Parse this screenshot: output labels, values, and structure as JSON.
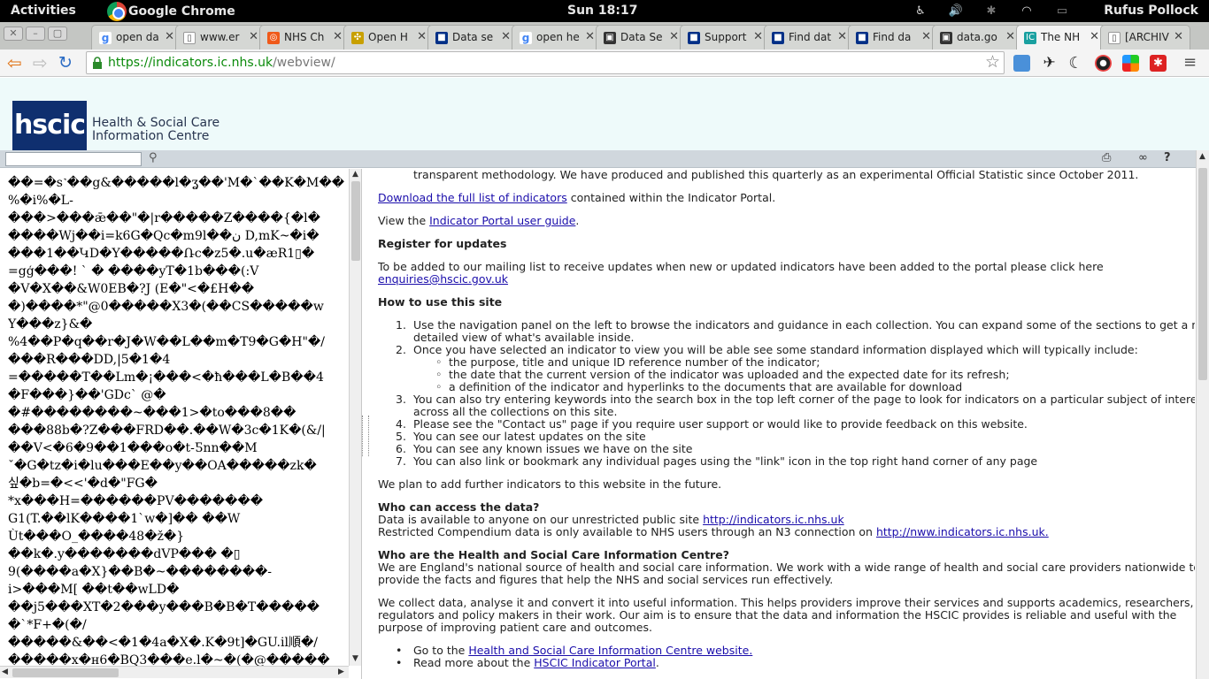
{
  "topbar": {
    "activities": "Activities",
    "app_name": "Google Chrome",
    "clock": "Sun 18:17",
    "user": "Rufus Pollock",
    "tray_icons": [
      "accessibility-icon",
      "volume-icon",
      "bluetooth-icon",
      "wifi-icon",
      "battery-icon"
    ]
  },
  "tabs": [
    {
      "label": "open da",
      "icon": "google-icon",
      "color": "#4285f4",
      "glyph": "g"
    },
    {
      "label": "www.er",
      "icon": "document-icon",
      "color": "#ffffff",
      "glyph": "▯"
    },
    {
      "label": "NHS Ch",
      "icon": "nhs-choices-icon",
      "color": "#f05a1a",
      "glyph": "◎"
    },
    {
      "label": "Open H",
      "icon": "open-h-icon",
      "color": "#c8a000",
      "glyph": "✣"
    },
    {
      "label": "Data se",
      "icon": "data-icon",
      "color": "#003087",
      "glyph": "■"
    },
    {
      "label": "open he",
      "icon": "google-icon",
      "color": "#4285f4",
      "glyph": "g"
    },
    {
      "label": "Data Se",
      "icon": "data-icon",
      "color": "#333333",
      "glyph": "▣"
    },
    {
      "label": "Support",
      "icon": "data-icon",
      "color": "#003087",
      "glyph": "■"
    },
    {
      "label": "Find dat",
      "icon": "data-icon",
      "color": "#003087",
      "glyph": "■"
    },
    {
      "label": "Find da",
      "icon": "data-icon",
      "color": "#003087",
      "glyph": "■"
    },
    {
      "label": "data.go",
      "icon": "datagov-icon",
      "color": "#333333",
      "glyph": "▣"
    },
    {
      "label": "The NH",
      "icon": "ic-icon",
      "color": "#1aa0a0",
      "glyph": "IC"
    },
    {
      "label": "[ARCHIV",
      "icon": "document-icon",
      "color": "#ffffff",
      "glyph": "▯"
    }
  ],
  "active_tab": 11,
  "address": {
    "domain": "https://indicators.ic.nhs.uk",
    "path": "/webview/"
  },
  "header": {
    "logo": "hscic",
    "org_line1": "Health & Social Care",
    "org_line2": "Information Centre"
  },
  "left_pane": {
    "garbled_lines": [
      "��=�s˺��g&�����l�ʓ��'M�`��K�M��",
      "%�i%�L-",
      "���>���ǣ��\"�|r�����Z����{�l�",
      "����Wj��i=k6G�Qc�m9l��ن D,mK~�i�",
      "���1��ԿD�Y�����Ռc�z5�.u�æR1▯�",
      "=gģ���! ` � ����yT�1b���(:V",
      "�V�X��&W0EB�?J (E�\"<�£H��",
      "�)����*\"@0�����X3�(��CS�����w",
      "Y���z}&�",
      "%4��P�q��r�J�W��L��m�T9�G�H\"�/",
      "���R���DD,|5�1�4",
      "=�����T��Lm�¡���<�ħ���L�B��4",
      "�F���}��'GDc` @�",
      "�#��������~���1>�to���8��",
      "���88b�?Z���FRD��.��W�3c�1K�(&/|",
      "��V<�6�9��1���o�t-Ƽnn��M",
      "ˇ�G�tz�i�lu���E��y��OA�����zk�",
      "싶�b=�<<'�d�\"FG�",
      "*x���H=������PV�������",
      "G1(T.��lK����1`w�]�� ��W",
      "Ùt���O_����48�ž�}",
      "��k�.y�������dVP��� �▯",
      "9(����a�X}��B�~��������-",
      "i>���M[ ��t��wLD�",
      "��j5���XT�2���y���B�B�T�����",
      "�`*F+�(�/",
      "�����&��<�1�4a�X�.K�9t]�GU.il順�/",
      "�����x�н6�BQ3���e.l�~�(�@�����"
    ]
  },
  "content": {
    "intro_tail": "transparent methodology. We have produced and published this quarterly as an experimental Official Statistic since October 2011.",
    "download_link": "Download the full list of indicators",
    "download_rest": " contained within the Indicator Portal.",
    "guide_pre": "View the ",
    "guide_link": "Indicator Portal user guide",
    "guide_post": ".",
    "register_heading": "Register for updates",
    "register_text": "To be added to our mailing list to receive updates when new or updated indicators have been added to the portal please click here",
    "register_email": "enquiries@hscic.gov.uk",
    "howto_heading": "How to use this site",
    "steps": [
      {
        "num": "1.",
        "lines": [
          "Use the navigation panel on the left to browse the indicators and guidance in each collection. You can expand some of the sections to get a more",
          "detailed view of what's available inside."
        ]
      },
      {
        "num": "2.",
        "lines": [
          "Once you have selected an indicator to view you will be able see some standard information displayed which will typically include:"
        ]
      },
      {
        "num": "3.",
        "lines": [
          "You can also try entering keywords into the search box in the top left corner of the page to look for indicators on a particular subject of interest",
          "across all the collections on this site."
        ]
      },
      {
        "num": "4.",
        "lines": [
          "Please see the \"Contact us\" page if you require user support or would like to provide feedback on this website."
        ]
      },
      {
        "num": "5.",
        "lines": [
          "You can see our latest updates on the site"
        ]
      },
      {
        "num": "6.",
        "lines": [
          "You can see any known issues we have on the site"
        ]
      },
      {
        "num": "7.",
        "lines": [
          "You can also link or bookmark any individual pages using the \"link\" icon in the top right hand corner of any page"
        ]
      }
    ],
    "sub_items": [
      "the purpose, title and unique ID reference number of the indicator;",
      "the date that the current version of the indicator was uploaded and the expected date for its refresh;",
      "a definition of the indicator and hyperlinks to the documents that are available for download"
    ],
    "future_text": "We plan to add further indicators to this website in the future.",
    "access_heading": "Who can access the data?",
    "access_line1": "Data is available to anyone on our unrestricted public site ",
    "access_link1": "http://indicators.ic.nhs.uk",
    "access_line2": "Restricted Compendium data is only available to NHS users through an N3 connection on ",
    "access_link2": "http://nww.indicators.ic.nhs.uk.",
    "who_heading": "Who are the Health and Social Care Information Centre?",
    "who_p1_l1": "We are England's national source of health and social care information. We work with a wide range of health and social care providers nationwide to",
    "who_p1_l2": "provide the facts and figures that help the NHS and social services run effectively.",
    "who_p2_l1": "We collect data, analyse it and convert it into useful information. This helps providers improve their services and supports academics, researchers,",
    "who_p2_l2": "regulators and policy makers in their work. Our aim is to ensure that the data and information the HSCIC provides is reliable and useful with the",
    "who_p2_l3": "purpose of improving patient care and outcomes.",
    "goto_pre": "Go to the ",
    "goto_link": "Health and Social Care Information Centre website.",
    "read_pre": "Read more about the ",
    "read_link": "HSCIC Indicator Portal",
    "read_post": "."
  }
}
